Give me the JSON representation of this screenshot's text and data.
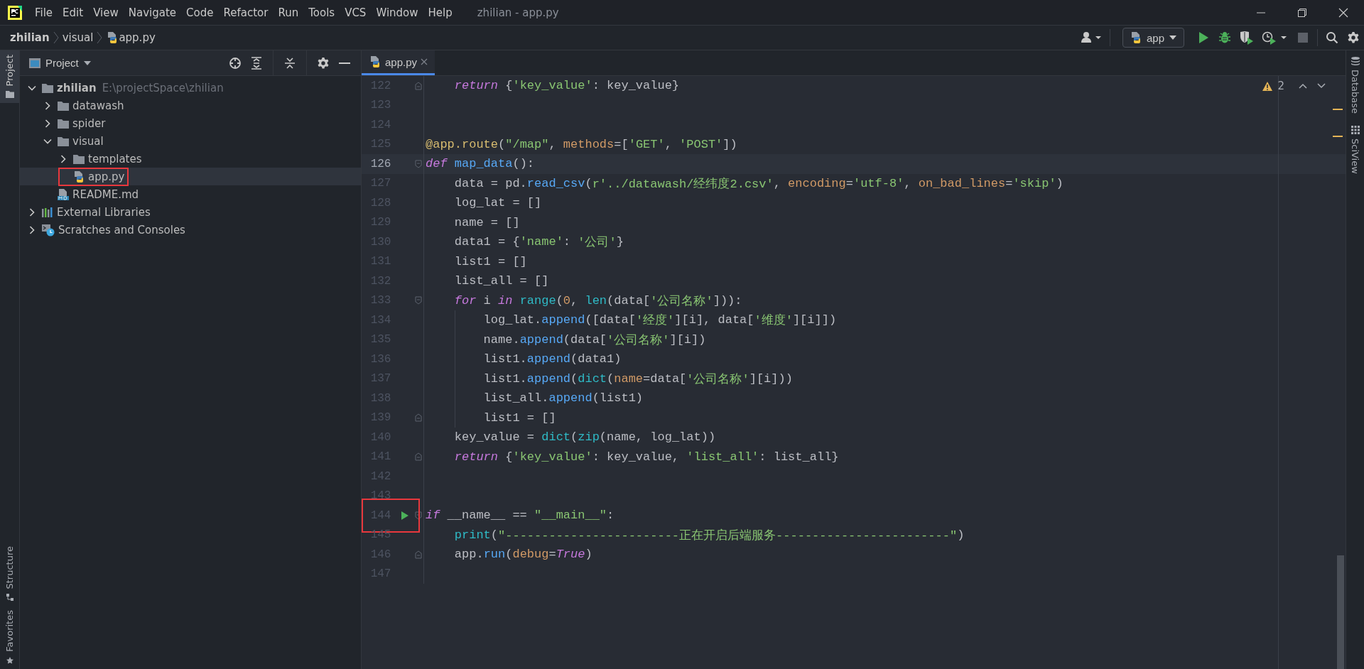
{
  "menu_bar": {
    "items": [
      "File",
      "Edit",
      "View",
      "Navigate",
      "Code",
      "Refactor",
      "Run",
      "Tools",
      "VCS",
      "Window",
      "Help"
    ],
    "title": "zhilian - app.py"
  },
  "breadcrumbs": [
    {
      "label": "zhilian",
      "kind": "project"
    },
    {
      "label": "visual",
      "kind": "folder"
    },
    {
      "label": "app.py",
      "kind": "python"
    }
  ],
  "toolbar": {
    "run_config": "app"
  },
  "left_stripe": [
    {
      "label": "Project",
      "kind": "project",
      "selected": true
    },
    {
      "label": "Structure",
      "kind": "structure",
      "selected": false
    },
    {
      "label": "Favorites",
      "kind": "favorites",
      "selected": false
    }
  ],
  "project_panel": {
    "title": "Project",
    "tree": [
      {
        "label": "zhilian",
        "path": "E:\\projectSpace\\zhilian",
        "kind": "folder",
        "expanded": true,
        "selected": false,
        "children": [
          {
            "label": "datawash",
            "kind": "folder",
            "expanded": false,
            "selected": false
          },
          {
            "label": "spider",
            "kind": "folder",
            "expanded": false,
            "selected": false
          },
          {
            "label": "visual",
            "kind": "folder",
            "expanded": true,
            "selected": false,
            "children": [
              {
                "label": "templates",
                "kind": "folder",
                "expanded": false,
                "selected": false
              },
              {
                "label": "app.py",
                "kind": "python",
                "selected": true,
                "annotated": true
              }
            ]
          },
          {
            "label": "README.md",
            "kind": "markdown",
            "selected": false
          }
        ]
      },
      {
        "label": "External Libraries",
        "kind": "libraries",
        "expanded": false,
        "selected": false
      },
      {
        "label": "Scratches and Consoles",
        "kind": "scratches",
        "expanded": false,
        "selected": false
      }
    ]
  },
  "editor": {
    "tabs": [
      {
        "label": "app.py",
        "kind": "python",
        "selected": true
      }
    ],
    "warnings": "2",
    "lines": [
      {
        "number": "122",
        "fold_end": true,
        "current": false,
        "tokens": [
          {
            "kind": "kw",
            "text": "    return"
          },
          {
            "kind": "plain",
            "text": " {"
          },
          {
            "kind": "str",
            "text": "'key_value'"
          },
          {
            "kind": "plain",
            "text": ": key_value}"
          }
        ]
      },
      {
        "number": "123",
        "current": false
      },
      {
        "number": "124",
        "current": false
      },
      {
        "number": "125",
        "current": false,
        "tokens": [
          {
            "kind": "deco",
            "text": "@app.route"
          },
          {
            "kind": "plain",
            "text": "("
          },
          {
            "kind": "str",
            "text": "\"/map\""
          },
          {
            "kind": "plain",
            "text": ", "
          },
          {
            "kind": "param",
            "text": "methods"
          },
          {
            "kind": "plain",
            "text": "=["
          },
          {
            "kind": "str",
            "text": "'GET'"
          },
          {
            "kind": "plain",
            "text": ", "
          },
          {
            "kind": "str",
            "text": "'POST'"
          },
          {
            "kind": "plain",
            "text": "])"
          }
        ]
      },
      {
        "number": "126",
        "fold_start": true,
        "current": true,
        "tokens": [
          {
            "kind": "kw",
            "text": "def"
          },
          {
            "kind": "fn",
            "text": " map_data"
          },
          {
            "kind": "plain",
            "text": "():"
          }
        ]
      },
      {
        "number": "127",
        "current": false,
        "tokens": [
          {
            "kind": "plain",
            "text": "    data = pd."
          },
          {
            "kind": "fn",
            "text": "read_csv"
          },
          {
            "kind": "plain",
            "text": "("
          },
          {
            "kind": "str",
            "text": "r'../datawash/经纬度2.csv'"
          },
          {
            "kind": "plain",
            "text": ", "
          },
          {
            "kind": "param",
            "text": "encoding"
          },
          {
            "kind": "plain",
            "text": "="
          },
          {
            "kind": "str",
            "text": "'utf-8'"
          },
          {
            "kind": "plain",
            "text": ", "
          },
          {
            "kind": "param",
            "text": "on_bad_lines"
          },
          {
            "kind": "plain",
            "text": "="
          },
          {
            "kind": "str",
            "text": "'skip'"
          },
          {
            "kind": "plain",
            "text": ")"
          }
        ]
      },
      {
        "number": "128",
        "current": false,
        "tokens": [
          {
            "kind": "plain",
            "text": "    log_lat = []"
          }
        ]
      },
      {
        "number": "129",
        "current": false,
        "tokens": [
          {
            "kind": "plain",
            "text": "    name = []"
          }
        ]
      },
      {
        "number": "130",
        "current": false,
        "tokens": [
          {
            "kind": "plain",
            "text": "    data1 = {"
          },
          {
            "kind": "str",
            "text": "'name'"
          },
          {
            "kind": "plain",
            "text": ": "
          },
          {
            "kind": "str",
            "text": "'公司'"
          },
          {
            "kind": "plain",
            "text": "}"
          }
        ]
      },
      {
        "number": "131",
        "current": false,
        "tokens": [
          {
            "kind": "plain",
            "text": "    list1 = []"
          }
        ]
      },
      {
        "number": "132",
        "current": false,
        "tokens": [
          {
            "kind": "plain",
            "text": "    list_all = []"
          }
        ]
      },
      {
        "number": "133",
        "fold_start": true,
        "current": false,
        "tokens": [
          {
            "kind": "kw",
            "text": "    for"
          },
          {
            "kind": "plain",
            "text": " i "
          },
          {
            "kind": "kw",
            "text": "in"
          },
          {
            "kind": "builtin",
            "text": " range"
          },
          {
            "kind": "plain",
            "text": "("
          },
          {
            "kind": "num",
            "text": "0"
          },
          {
            "kind": "plain",
            "text": ", "
          },
          {
            "kind": "builtin",
            "text": "len"
          },
          {
            "kind": "plain",
            "text": "(data["
          },
          {
            "kind": "str",
            "text": "'公司名称'"
          },
          {
            "kind": "plain",
            "text": "])):"
          }
        ]
      },
      {
        "number": "134",
        "current": false,
        "tokens": [
          {
            "kind": "plain",
            "text": "        log_lat."
          },
          {
            "kind": "fn",
            "text": "append"
          },
          {
            "kind": "plain",
            "text": "([data["
          },
          {
            "kind": "str",
            "text": "'经度'"
          },
          {
            "kind": "plain",
            "text": "][i], data["
          },
          {
            "kind": "str",
            "text": "'维度'"
          },
          {
            "kind": "plain",
            "text": "][i]])"
          }
        ]
      },
      {
        "number": "135",
        "current": false,
        "tokens": [
          {
            "kind": "plain",
            "text": "        name."
          },
          {
            "kind": "fn",
            "text": "append"
          },
          {
            "kind": "plain",
            "text": "(data["
          },
          {
            "kind": "str",
            "text": "'公司名称'"
          },
          {
            "kind": "plain",
            "text": "][i])"
          }
        ]
      },
      {
        "number": "136",
        "current": false,
        "tokens": [
          {
            "kind": "plain",
            "text": "        list1."
          },
          {
            "kind": "fn",
            "text": "append"
          },
          {
            "kind": "plain",
            "text": "(data1)"
          }
        ]
      },
      {
        "number": "137",
        "current": false,
        "tokens": [
          {
            "kind": "plain",
            "text": "        list1."
          },
          {
            "kind": "fn",
            "text": "append"
          },
          {
            "kind": "plain",
            "text": "("
          },
          {
            "kind": "builtin",
            "text": "dict"
          },
          {
            "kind": "plain",
            "text": "("
          },
          {
            "kind": "param",
            "text": "name"
          },
          {
            "kind": "plain",
            "text": "=data["
          },
          {
            "kind": "str",
            "text": "'公司名称'"
          },
          {
            "kind": "plain",
            "text": "][i]))"
          }
        ]
      },
      {
        "number": "138",
        "current": false,
        "tokens": [
          {
            "kind": "plain",
            "text": "        list_all."
          },
          {
            "kind": "fn",
            "text": "append"
          },
          {
            "kind": "plain",
            "text": "(list1)"
          }
        ]
      },
      {
        "number": "139",
        "fold_end": true,
        "current": false,
        "tokens": [
          {
            "kind": "plain",
            "text": "        list1 = []"
          }
        ]
      },
      {
        "number": "140",
        "current": false,
        "tokens": [
          {
            "kind": "plain",
            "text": "    key_value = "
          },
          {
            "kind": "builtin",
            "text": "dict"
          },
          {
            "kind": "plain",
            "text": "("
          },
          {
            "kind": "builtin",
            "text": "zip"
          },
          {
            "kind": "plain",
            "text": "(name, log_lat))"
          }
        ]
      },
      {
        "number": "141",
        "fold_end": true,
        "current": false,
        "tokens": [
          {
            "kind": "kw",
            "text": "    return"
          },
          {
            "kind": "plain",
            "text": " {"
          },
          {
            "kind": "str",
            "text": "'key_value'"
          },
          {
            "kind": "plain",
            "text": ": key_value, "
          },
          {
            "kind": "str",
            "text": "'list_all'"
          },
          {
            "kind": "plain",
            "text": ": list_all}"
          }
        ]
      },
      {
        "number": "142",
        "current": false
      },
      {
        "number": "143",
        "current": false
      },
      {
        "number": "144",
        "fold_start": true,
        "current": false,
        "run_marker": true,
        "annotated": true,
        "tokens": [
          {
            "kind": "kw",
            "text": "if"
          },
          {
            "kind": "plain",
            "text": " __name__ == "
          },
          {
            "kind": "str",
            "text": "\"__main__\""
          },
          {
            "kind": "plain",
            "text": ":"
          }
        ]
      },
      {
        "number": "145",
        "current": false,
        "tokens": [
          {
            "kind": "builtin",
            "text": "    print"
          },
          {
            "kind": "plain",
            "text": "("
          },
          {
            "kind": "str",
            "text": "\"------------------------正在开启后端服务------------------------\""
          },
          {
            "kind": "plain",
            "text": ")"
          }
        ]
      },
      {
        "number": "146",
        "fold_end": true,
        "current": false,
        "tokens": [
          {
            "kind": "plain",
            "text": "    app."
          },
          {
            "kind": "fn",
            "text": "run"
          },
          {
            "kind": "plain",
            "text": "("
          },
          {
            "kind": "param",
            "text": "debug"
          },
          {
            "kind": "plain",
            "text": "="
          },
          {
            "kind": "kw",
            "text": "True"
          },
          {
            "kind": "plain",
            "text": ")"
          }
        ]
      },
      {
        "number": "147",
        "current": false
      }
    ]
  },
  "right_stripe": [
    {
      "label": "Database",
      "kind": "database"
    },
    {
      "label": "SciView",
      "kind": "sciview"
    }
  ]
}
